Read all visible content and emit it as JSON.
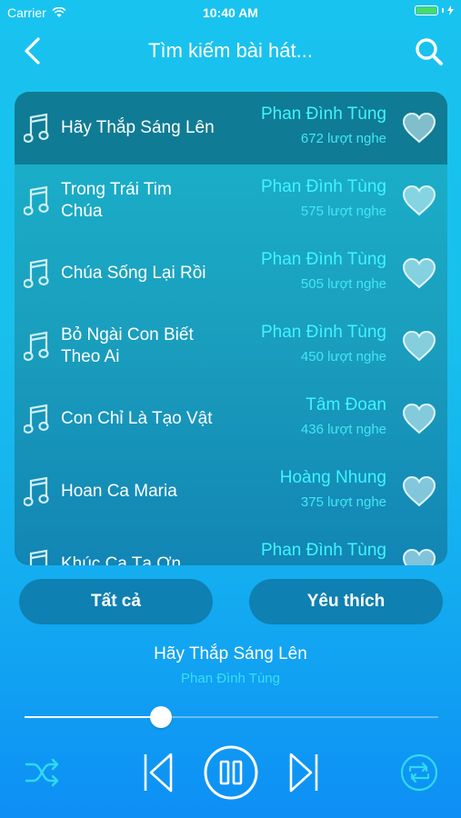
{
  "status": {
    "carrier": "Carrier",
    "time": "10:40 AM"
  },
  "nav": {
    "title": "Tìm kiếm bài hát...",
    "back_icon": "chevron-left-icon",
    "search_icon": "search-icon"
  },
  "songs": [
    {
      "title": "Hãy Thắp Sáng Lên",
      "artist": "Phan Đình Tùng",
      "plays": "672 lượt nghe",
      "active": true
    },
    {
      "title": "Trong Trái Tim Chúa",
      "artist": "Phan Đình Tùng",
      "plays": "575 lượt nghe"
    },
    {
      "title": "Chúa Sống Lại Rồi",
      "artist": "Phan Đình Tùng",
      "plays": "505 lượt nghe"
    },
    {
      "title": "Bỏ Ngài Con Biết Theo Ai",
      "artist": "Phan Đình Tùng",
      "plays": "450 lượt nghe"
    },
    {
      "title": "Con Chỉ Là Tạo Vật",
      "artist": "Tâm Đoan",
      "plays": "436 lượt nghe"
    },
    {
      "title": "Hoan Ca Maria",
      "artist": "Hoàng Nhung",
      "plays": "375 lượt nghe"
    },
    {
      "title": "Khúc Ca Tạ Ơn",
      "artist": "Phan Đình Tùng",
      "plays": ""
    }
  ],
  "tabs": {
    "all": "Tất cả",
    "favorites": "Yêu thích"
  },
  "now_playing": {
    "title": "Hãy Thắp Sáng Lên",
    "artist": "Phan Đình Tùng",
    "progress": 0.33
  },
  "colors": {
    "accent": "#3ff4ff",
    "panel_active": "#107b94",
    "button_bg": "#0f80b2"
  }
}
